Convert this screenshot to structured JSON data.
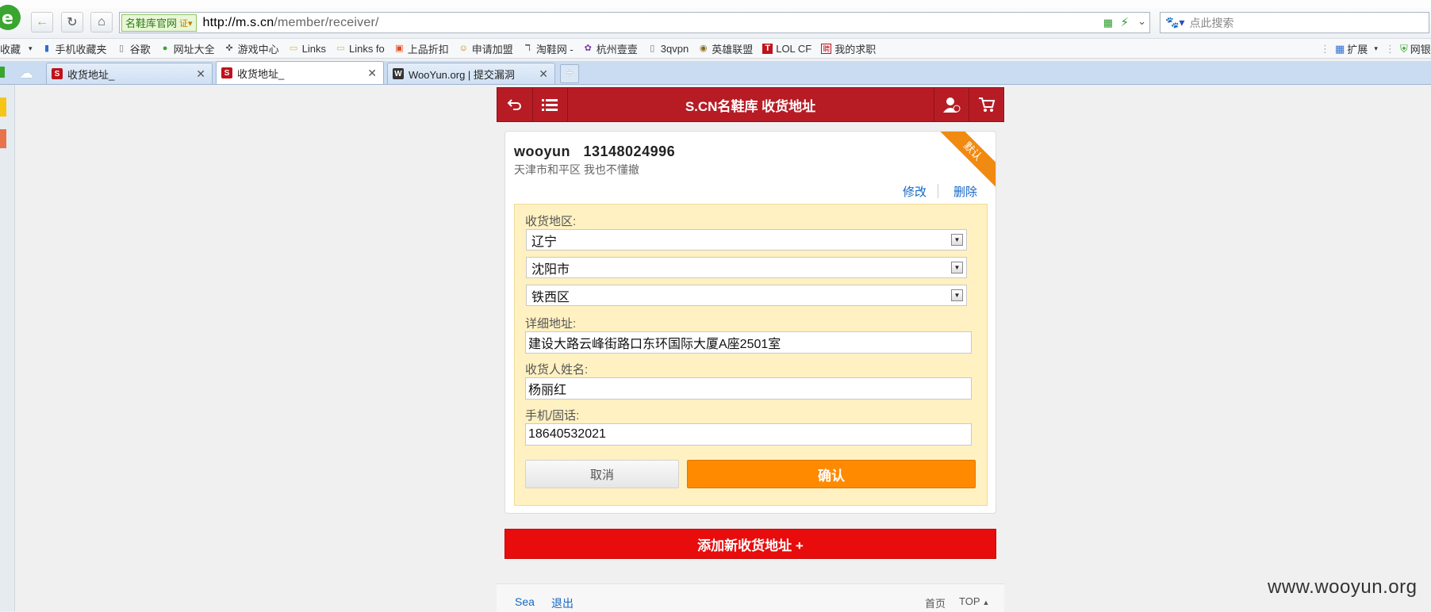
{
  "browser": {
    "url_host": "http://m.s.cn",
    "url_path": "/member/receiver/",
    "site_badge": "名鞋库官网",
    "search_placeholder": "点此搜索",
    "favorites_label": "收藏",
    "bookmarks": [
      "手机收藏夹",
      "谷歌",
      "网址大全",
      "游戏中心",
      "Links",
      "Links fo",
      "上品折扣",
      "申请加盟",
      "淘鞋网 -",
      "杭州壹壹",
      "3qvpn",
      "英雄联盟",
      "LOL CF",
      "我的求职"
    ],
    "extensions_label": "扩展",
    "bank_label": "网银",
    "tabs": [
      {
        "title": "收货地址_",
        "active": false
      },
      {
        "title": "收货地址_",
        "active": true
      },
      {
        "title": "WooYun.org | 提交漏洞",
        "active": false
      }
    ]
  },
  "page": {
    "title": "S.CN名鞋库 收货地址",
    "card": {
      "name_phone": "wooyun   13148024996",
      "address_summary": "天津市和平区 我也不懂撤",
      "default_ribbon": "默认",
      "edit_label": "修改",
      "delete_label": "删除"
    },
    "form": {
      "region_label": "收货地区:",
      "province": "辽宁",
      "city": "沈阳市",
      "district": "铁西区",
      "detail_label": "详细地址:",
      "detail_value": "建设大路云峰街路口东环国际大厦A座2501室",
      "name_label": "收货人姓名:",
      "name_value": "杨丽红",
      "phone_label": "手机/固话:",
      "phone_value": "18640532021",
      "cancel_label": "取消",
      "confirm_label": "确认"
    },
    "add_new_label": "添加新收货地址 +",
    "footer": {
      "search": "Sea",
      "logout": "退出",
      "home": "首页",
      "top": "TOP"
    }
  },
  "watermark": "www.wooyun.org",
  "colors": {
    "header_red": "#b71c25",
    "confirm_orange": "#ff8a00",
    "add_red": "#e80c0c",
    "form_bg": "#fff1c2",
    "link_blue": "#1467c4"
  }
}
